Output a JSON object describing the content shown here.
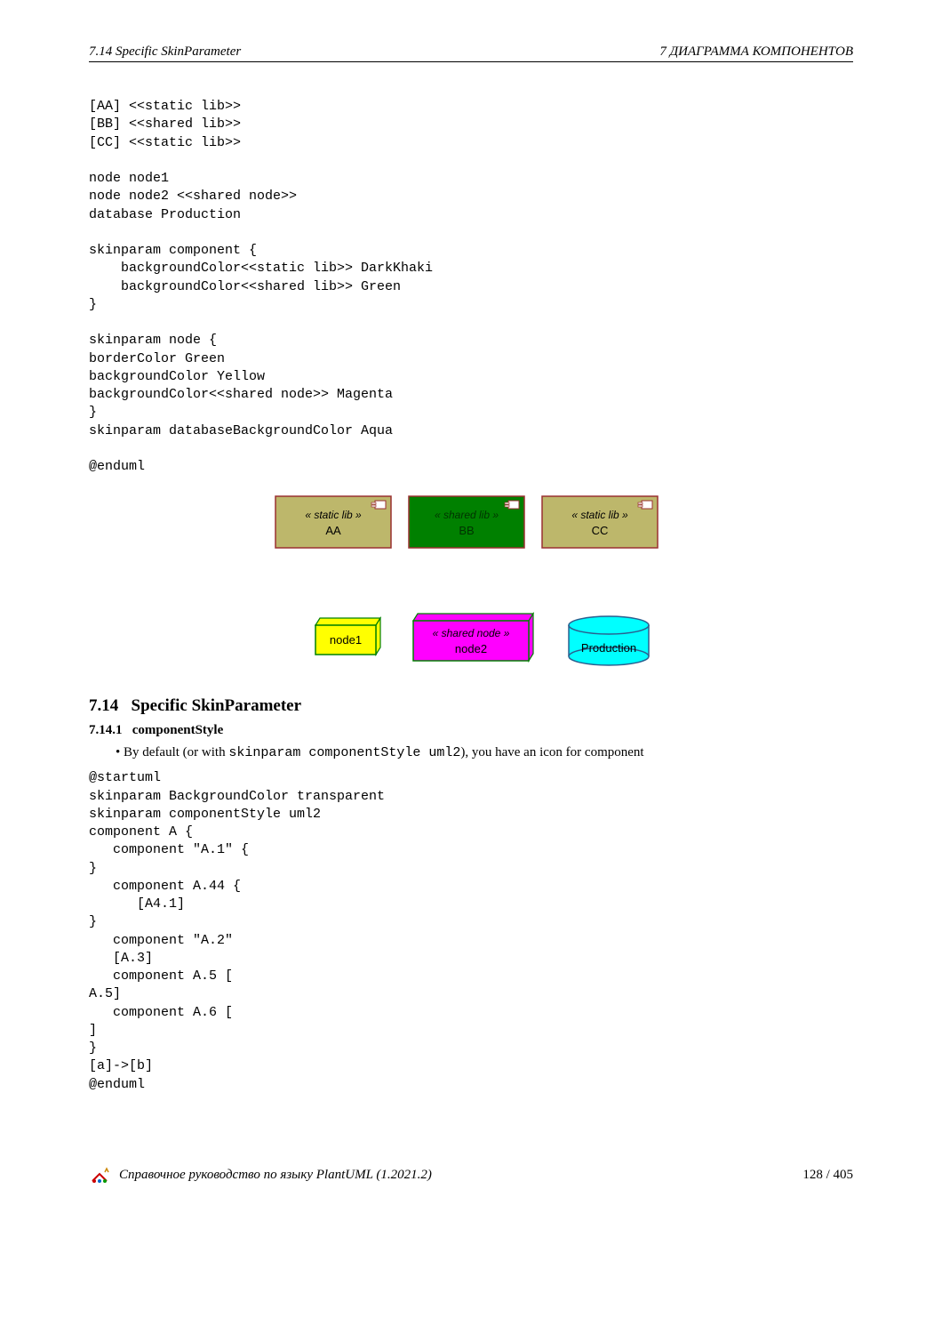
{
  "header": {
    "left": "7.14   Specific SkinParameter",
    "right": "7   ДИАГРАММА КОМПОНЕНТОВ"
  },
  "code1": "[AA] <<static lib>>\n[BB] <<shared lib>>\n[CC] <<static lib>>\n\nnode node1\nnode node2 <<shared node>>\ndatabase Production\n\nskinparam component {\n    backgroundColor<<static lib>> DarkKhaki\n    backgroundColor<<shared lib>> Green\n}\n\nskinparam node {\nborderColor Green\nbackgroundColor Yellow\nbackgroundColor<<shared node>> Magenta\n}\nskinparam databaseBackgroundColor Aqua\n\n@enduml",
  "diagram": {
    "components": [
      {
        "stereo": "« static lib »",
        "name": "AA",
        "fill": "#bdb76b"
      },
      {
        "stereo": "« shared lib »",
        "name": "BB",
        "fill": "#008000"
      },
      {
        "stereo": "« static lib »",
        "name": "CC",
        "fill": "#bdb76b"
      }
    ],
    "node1": {
      "label": "node1"
    },
    "node2": {
      "stereo": "« shared node »",
      "label": "node2"
    },
    "db": {
      "label": "Production"
    }
  },
  "section": {
    "num": "7.14",
    "title": "Specific SkinParameter",
    "subnum": "7.14.1",
    "subtitle": "componentStyle",
    "bullet_pre": "By default (or with ",
    "bullet_code": "skinparam componentStyle uml2",
    "bullet_post": "), you have an icon for component"
  },
  "code2": "@startuml\nskinparam BackgroundColor transparent\nskinparam componentStyle uml2\ncomponent A {\n   component \"A.1\" {\n}\n   component A.44 {\n      [A4.1]\n}\n   component \"A.2\"\n   [A.3]\n   component A.5 [\nA.5]\n   component A.6 [\n]\n}\n[a]->[b]\n@enduml",
  "footer": {
    "text": "Справочное руководство по языку PlantUML (1.2021.2)",
    "page": "128 / 405"
  }
}
